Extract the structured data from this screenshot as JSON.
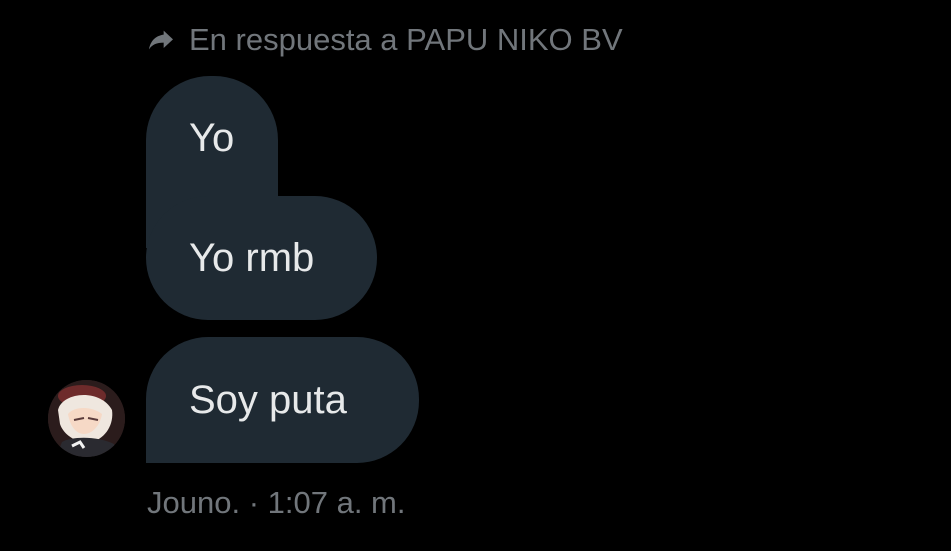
{
  "reply": {
    "icon": "reply-arrow-icon",
    "text": "En respuesta a PAPU NIKO BV"
  },
  "messages": [
    {
      "text": "Yo"
    },
    {
      "text": "Yo rmb"
    },
    {
      "text": "Soy puta"
    }
  ],
  "sender": {
    "avatar": "user-avatar",
    "name": "Jouno.",
    "separator": " · ",
    "time": "1:07 a. m."
  },
  "colors": {
    "background": "#000000",
    "bubble": "#1f2a33",
    "text": "#e7e9ea",
    "muted": "#71767b"
  }
}
